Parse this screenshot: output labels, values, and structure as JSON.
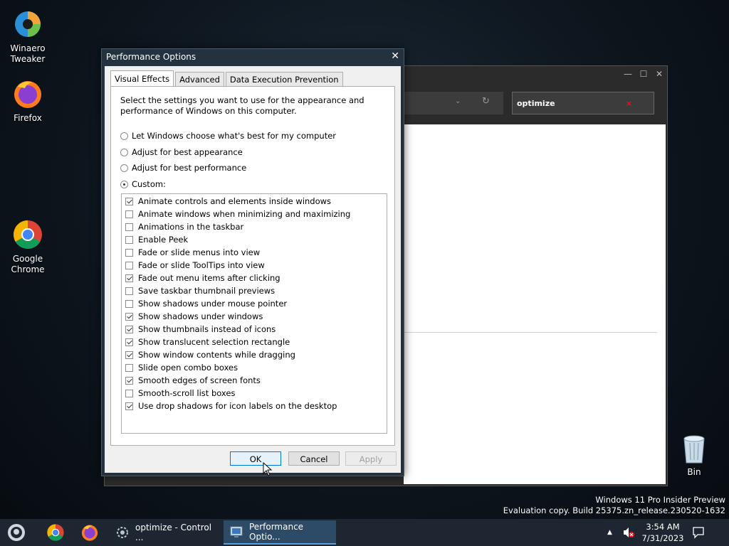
{
  "desktop": {
    "icons": [
      {
        "label_line1": "Winaero",
        "label_line2": "Tweaker"
      },
      {
        "label_line1": "Firefox",
        "label_line2": ""
      },
      {
        "label_line1": "Google",
        "label_line2": "Chrome"
      }
    ],
    "recycle_bin_label": "Bin"
  },
  "background_window": {
    "search_value": "optimize",
    "search_clear": "×",
    "controls": {
      "minimize": "—",
      "maximize": "☐",
      "close": "✕"
    }
  },
  "dialog": {
    "title": "Performance Options",
    "close_glyph": "✕",
    "tabs": [
      "Visual Effects",
      "Advanced",
      "Data Execution Prevention"
    ],
    "description": "Select the settings you want to use for the appearance and performance of Windows on this computer.",
    "radios": [
      {
        "label": "Let Windows choose what's best for my computer",
        "selected": false
      },
      {
        "label": "Adjust for best appearance",
        "selected": false
      },
      {
        "label": "Adjust for best performance",
        "selected": false
      },
      {
        "label": "Custom:",
        "selected": true
      }
    ],
    "effects": [
      {
        "label": "Animate controls and elements inside windows",
        "checked": true
      },
      {
        "label": "Animate windows when minimizing and maximizing",
        "checked": false
      },
      {
        "label": "Animations in the taskbar",
        "checked": false
      },
      {
        "label": "Enable Peek",
        "checked": false
      },
      {
        "label": "Fade or slide menus into view",
        "checked": false
      },
      {
        "label": "Fade or slide ToolTips into view",
        "checked": false
      },
      {
        "label": "Fade out menu items after clicking",
        "checked": true
      },
      {
        "label": "Save taskbar thumbnail previews",
        "checked": false
      },
      {
        "label": "Show shadows under mouse pointer",
        "checked": false
      },
      {
        "label": "Show shadows under windows",
        "checked": true
      },
      {
        "label": "Show thumbnails instead of icons",
        "checked": true
      },
      {
        "label": "Show translucent selection rectangle",
        "checked": true
      },
      {
        "label": "Show window contents while dragging",
        "checked": true
      },
      {
        "label": "Slide open combo boxes",
        "checked": false
      },
      {
        "label": "Smooth edges of screen fonts",
        "checked": true
      },
      {
        "label": "Smooth-scroll list boxes",
        "checked": false
      },
      {
        "label": "Use drop shadows for icon labels on the desktop",
        "checked": true
      }
    ],
    "buttons": {
      "ok": "OK",
      "cancel": "Cancel",
      "apply": "Apply"
    }
  },
  "watermark": {
    "line1": "Windows 11 Pro Insider Preview",
    "line2": "Evaluation copy. Build 25375.zn_release.230520-1632"
  },
  "taskbar": {
    "apps": [
      {
        "label": "optimize - Control ...",
        "active": false
      },
      {
        "label": "Performance Optio...",
        "active": true
      }
    ],
    "time": "3:54 AM",
    "date": "7/31/2023"
  }
}
